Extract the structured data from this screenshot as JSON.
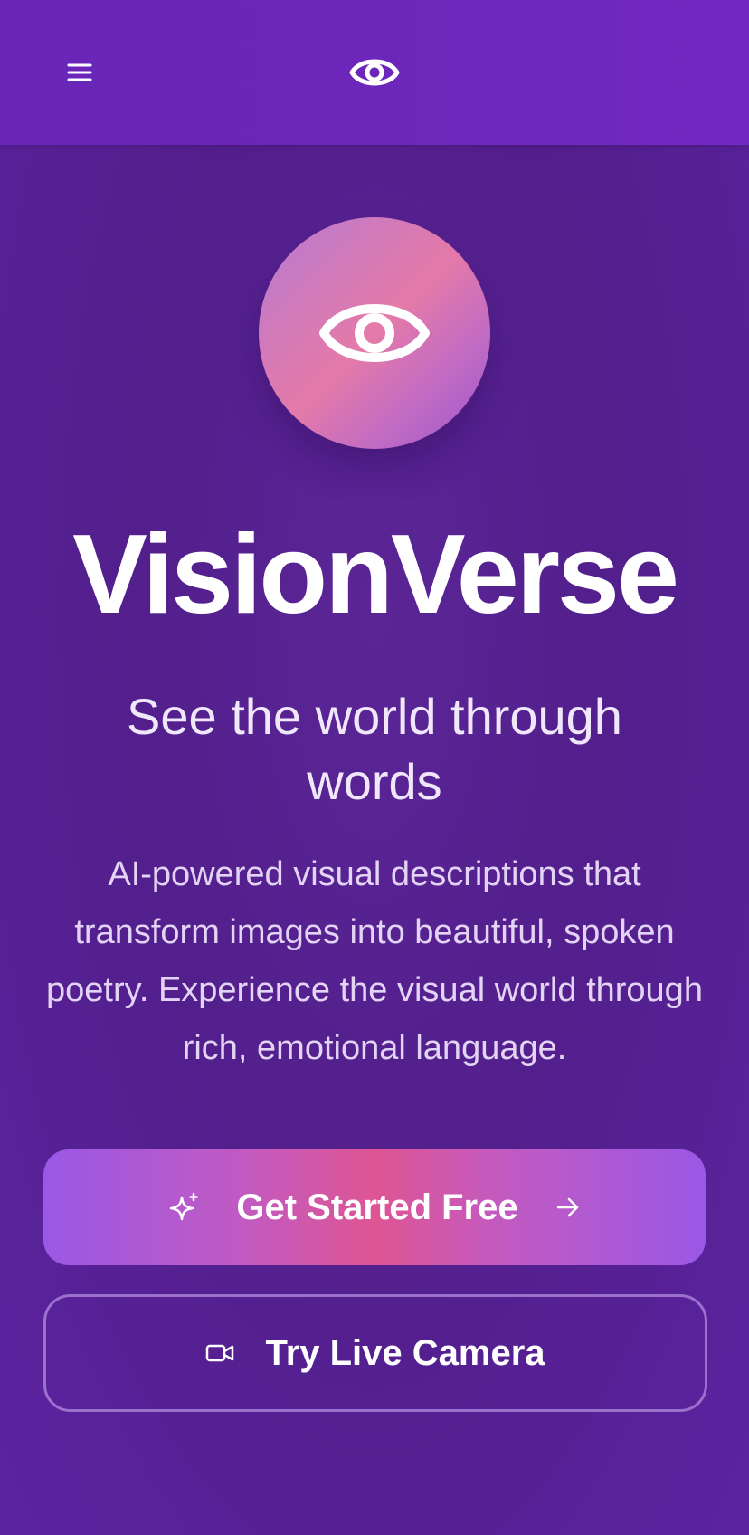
{
  "header": {
    "menu_icon": "menu-icon",
    "logo_icon": "eye-icon"
  },
  "hero": {
    "icon": "eye-icon",
    "title": "VisionVerse",
    "tagline": "See the world through words",
    "description": "AI-powered visual descriptions that transform images into beautiful, spoken poetry. Experience the visual world through rich, emotional language."
  },
  "actions": {
    "primary_label": "Get Started Free",
    "primary_icon": "sparkles-icon",
    "primary_trailing_icon": "arrow-right-icon",
    "secondary_label": "Try Live Camera",
    "secondary_icon": "video-camera-icon"
  },
  "colors": {
    "background": "#5a2496",
    "header": "#6c27bb",
    "primary_gradient": [
      "#9a58e6",
      "#de5593",
      "#9a58e6"
    ],
    "secondary_border": "#b28ce0",
    "text": "#ffffff"
  }
}
